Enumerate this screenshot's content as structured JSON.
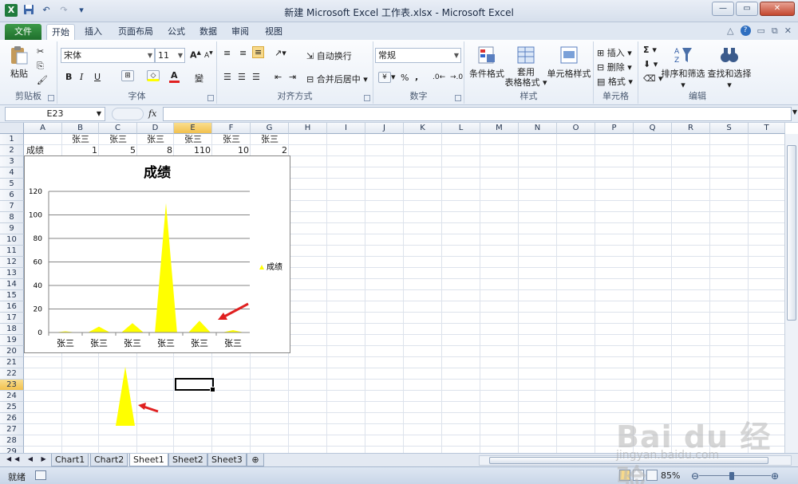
{
  "window": {
    "title": "新建 Microsoft Excel 工作表.xlsx - Microsoft Excel",
    "logo": "X",
    "min": "—",
    "restore": "▭",
    "close": "✕"
  },
  "qat": {
    "save_icon": "save-icon",
    "undo": "↶",
    "redo": "↷",
    "customize": "▾"
  },
  "tabs": {
    "file": "文件",
    "home": "开始",
    "insert": "插入",
    "layout": "页面布局",
    "formulas": "公式",
    "data": "数据",
    "review": "审阅",
    "view": "视图"
  },
  "ribbon": {
    "paste": "粘贴",
    "clipboard": "剪贴板",
    "font_name": "宋体",
    "font_size": "11",
    "font_group": "字体",
    "bold": "B",
    "italic": "I",
    "underline": "U",
    "grow_font": "A",
    "shrink_font": "A",
    "font_color_letter": "A",
    "phonetic": "變",
    "align_group": "对齐方式",
    "wrap_text": "自动换行",
    "merge_center": "合并后居中",
    "number_format": "常规",
    "number_group": "数字",
    "percent": "%",
    "comma": ",",
    "cond_format": "条件格式",
    "table_format_1": "套用",
    "table_format_2": "表格格式",
    "cell_styles": "单元格样式",
    "styles_group": "样式",
    "insert_cells": "插入",
    "delete_cells": "删除",
    "format_cells": "格式",
    "cells_group": "单元格",
    "autosum": "Σ",
    "sort_filter": "排序和筛选",
    "find_select": "查找和选择",
    "editing_group": "编辑"
  },
  "formula_bar": {
    "name_box": "E23",
    "fx": "fx",
    "value": ""
  },
  "columns": [
    "A",
    "B",
    "C",
    "D",
    "E",
    "F",
    "G",
    "H",
    "I",
    "J",
    "K",
    "L",
    "M",
    "N",
    "O",
    "P",
    "Q",
    "R",
    "S",
    "T"
  ],
  "selected_column": "E",
  "rows": [
    "1",
    "2",
    "3",
    "4",
    "5",
    "6",
    "7",
    "8",
    "9",
    "10",
    "11",
    "12",
    "13",
    "14",
    "15",
    "16",
    "17",
    "18",
    "19",
    "20",
    "21",
    "22",
    "23",
    "24",
    "25",
    "26",
    "27",
    "28",
    "29"
  ],
  "selected_row": "23",
  "cells": {
    "row1": [
      "",
      "张三",
      "张三",
      "张三",
      "张三",
      "张三",
      "张三"
    ],
    "row2_label": "成绩",
    "row2_values": [
      "1",
      "5",
      "8",
      "110",
      "10",
      "2"
    ]
  },
  "chart_data": {
    "type": "area",
    "title": "成绩",
    "categories": [
      "张三",
      "张三",
      "张三",
      "张三",
      "张三",
      "张三"
    ],
    "series": [
      {
        "name": "成绩",
        "values": [
          1,
          5,
          8,
          110,
          10,
          2
        ],
        "color": "#ffff00"
      }
    ],
    "ylim": [
      0,
      120
    ],
    "yticks": [
      "0",
      "20",
      "40",
      "60",
      "80",
      "100",
      "120"
    ],
    "grid": true,
    "legend": "right"
  },
  "annotations": {
    "arrow_color": "#e02020",
    "marker_color": "#ffff00"
  },
  "sheet_tabs": [
    "Chart1",
    "Chart2",
    "Sheet1",
    "Sheet2",
    "Sheet3"
  ],
  "active_sheet": "Sheet1",
  "status": {
    "text": "就绪",
    "zoom": "85%",
    "zoom_fraction": 0.85
  },
  "watermark": {
    "logo": "Bai du 经验",
    "url": "jingyan.baidu.com"
  }
}
